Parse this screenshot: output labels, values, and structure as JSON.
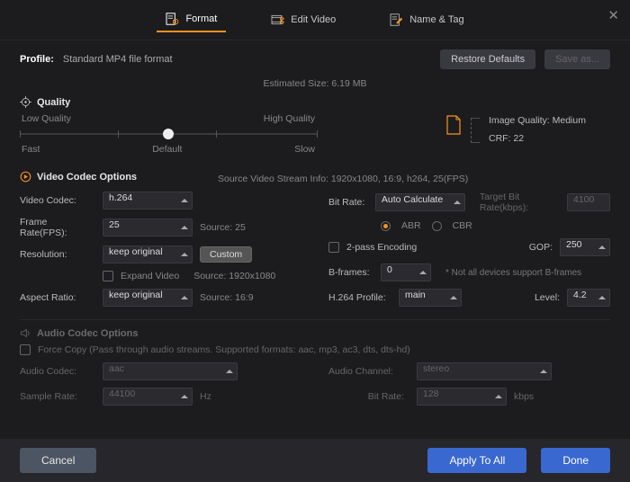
{
  "tabs": {
    "format": "Format",
    "edit": "Edit Video",
    "name": "Name & Tag"
  },
  "close": "✕",
  "profile": {
    "label": "Profile:",
    "value": "Standard MP4 file format"
  },
  "buttons": {
    "restore": "Restore Defaults",
    "saveas": "Save as...",
    "cancel": "Cancel",
    "applyAll": "Apply To All",
    "done": "Done",
    "custom": "Custom"
  },
  "estimated": "Estimated Size: 6.19 MB",
  "sections": {
    "quality": "Quality",
    "video": "Video Codec Options",
    "audio": "Audio Codec Options"
  },
  "quality": {
    "low": "Low Quality",
    "high": "High Quality",
    "fast": "Fast",
    "default": "Default",
    "slow": "Slow",
    "imgQuality": "Image Quality: Medium",
    "crf": "CRF: 22"
  },
  "sourceInfo": "Source Video Stream Info: 1920x1080, 16:9, h264, 25(FPS)",
  "labels": {
    "videoCodec": "Video Codec:",
    "frameRate": "Frame Rate(FPS):",
    "resolution": "Resolution:",
    "expand": "Expand Video",
    "aspect": "Aspect Ratio:",
    "bitrate": "Bit Rate:",
    "target": "Target Bit Rate(kbps):",
    "abr": "ABR",
    "cbr": "CBR",
    "twopass": "2-pass Encoding",
    "gop": "GOP:",
    "bframes": "B-frames:",
    "bnote": "* Not all devices support B-frames",
    "h264p": "H.264 Profile:",
    "level": "Level:",
    "sourceFps": "Source: 25",
    "sourceRes": "Source: 1920x1080",
    "sourceAR": "Source: 16:9",
    "forceCopy": "Force Copy (Pass through audio streams. Supported formats: aac, mp3, ac3, dts, dts-hd)",
    "audioCodec": "Audio Codec:",
    "audioChannel": "Audio Channel:",
    "sampleRate": "Sample Rate:",
    "hz": "Hz",
    "abitrate": "Bit Rate:",
    "kbps": "kbps"
  },
  "values": {
    "videoCodec": "h.264",
    "frameRate": "25",
    "resolution": "keep original",
    "aspect": "keep original",
    "bitrate": "Auto Calculate",
    "targetRate": "4100",
    "gop": "250",
    "bframes": "0",
    "h264p": "main",
    "level": "4.2",
    "audioCodec": "aac",
    "audioChannel": "stereo",
    "sampleRate": "44100",
    "abitrate": "128"
  }
}
